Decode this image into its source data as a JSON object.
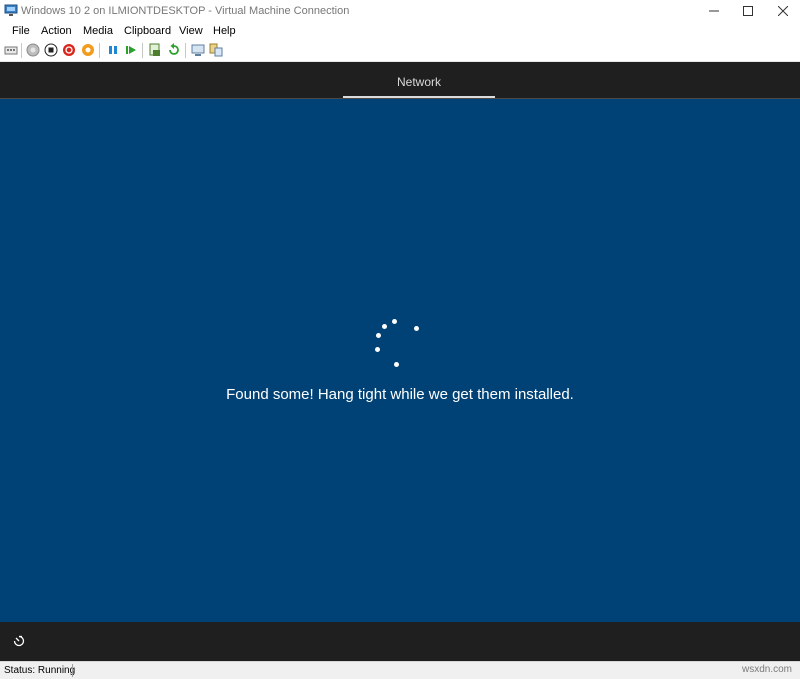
{
  "window": {
    "title": "Windows 10 2 on ILMIONTDESKTOP - Virtual Machine Connection"
  },
  "menubar": {
    "items": [
      "File",
      "Action",
      "Media",
      "Clipboard",
      "View",
      "Help"
    ]
  },
  "toolbar": {
    "icons": [
      "ctrl-alt-del-icon",
      "start-icon",
      "turn-off-icon",
      "shut-down-icon",
      "save-icon",
      "pause-icon",
      "resume-icon",
      "checkpoint-icon",
      "revert-icon",
      "enhanced-session-icon",
      "share-icon"
    ]
  },
  "vm": {
    "header_tab": "Network",
    "message": "Found some! Hang tight while we get them installed."
  },
  "statusbar": {
    "status": "Status: Running",
    "watermark": "wsxdn.com"
  },
  "colors": {
    "vm_background": "#004275",
    "vm_bars": "#1f1f1f",
    "text_white": "#ffffff"
  }
}
